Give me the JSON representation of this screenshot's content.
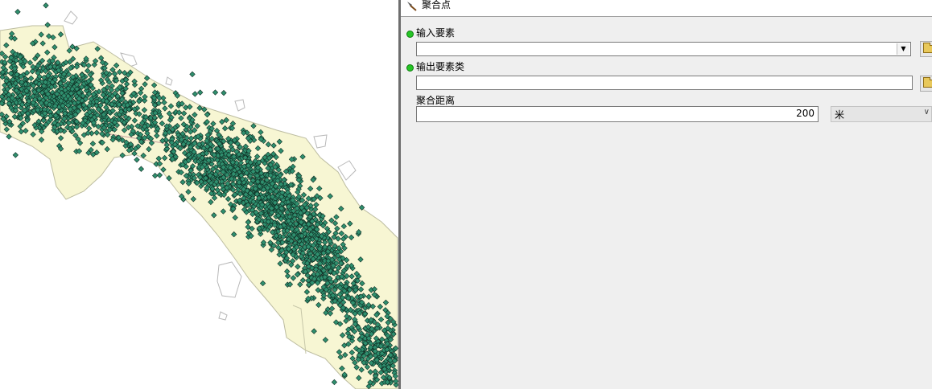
{
  "dialog": {
    "title": "聚合点",
    "input_label": "输入要素",
    "input_value": "",
    "output_label": "输出要素类",
    "output_value": "",
    "distance_label": "聚合距离",
    "distance_value": "200",
    "unit_value": "米"
  },
  "map": {
    "polygon_fill": "#f7f6d3",
    "point_fill": "#2f8f6e",
    "point_stroke": "#0f2f24"
  }
}
